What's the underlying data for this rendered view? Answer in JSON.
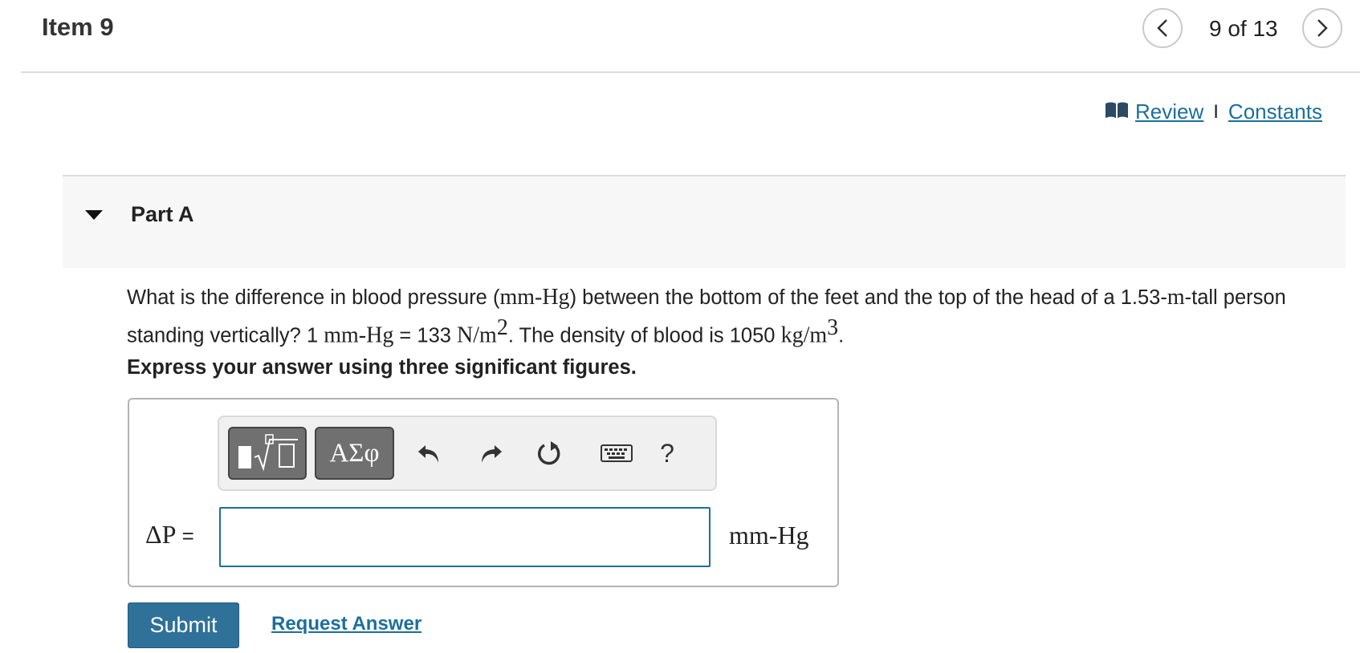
{
  "header": {
    "item_title": "Item 9",
    "pager_text": "9 of 13"
  },
  "links": {
    "review": "Review",
    "separator": "I",
    "constants": "Constants"
  },
  "part": {
    "title": "Part A"
  },
  "question": {
    "text1": "What is the difference in blood pressure (",
    "unit_mmhg": "mm-Hg",
    "text2": ") between the bottom of the feet and the top of the head of a 1.53-",
    "unit_m": "m",
    "text3": "-tall person standing vertically? 1 ",
    "text4": " = 133 ",
    "unit_nm": "N/m",
    "exp2": "2",
    "text5": ". The density of blood is 1050 ",
    "unit_kgm": "kg/m",
    "exp3": "3",
    "text6": "."
  },
  "instruction": "Express your answer using three significant figures.",
  "toolbar": {
    "greek_label": "ΑΣφ",
    "help_label": "?"
  },
  "answer": {
    "label_var": "ΔP",
    "label_eq": " =",
    "value": "",
    "unit": "mm-Hg"
  },
  "actions": {
    "submit": "Submit",
    "request_answer": "Request Answer"
  }
}
